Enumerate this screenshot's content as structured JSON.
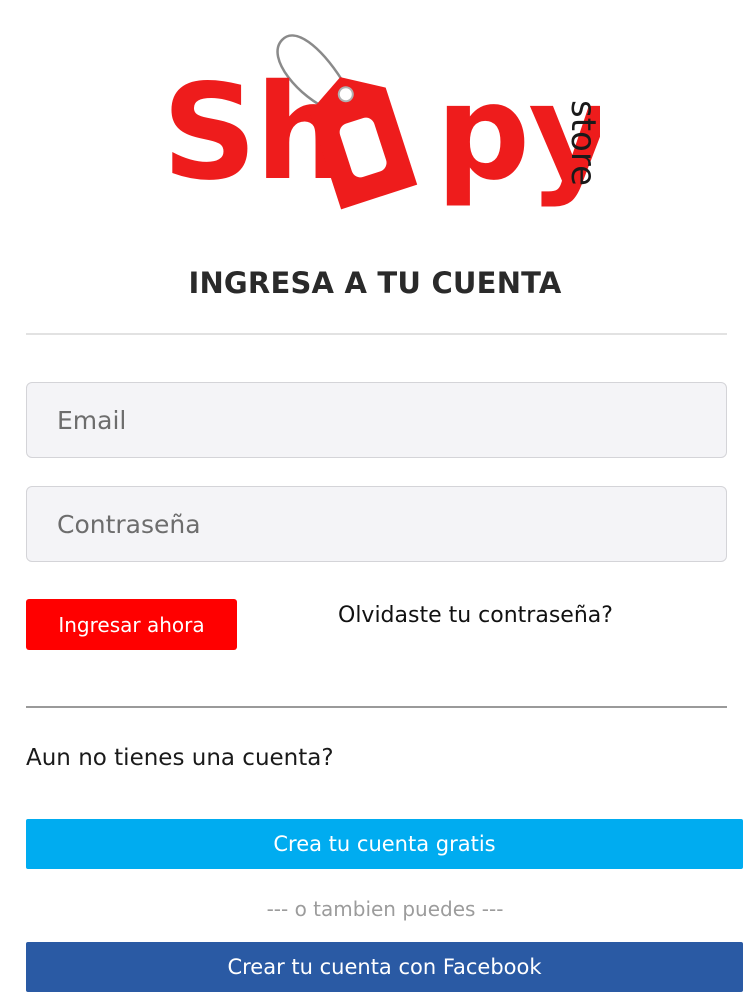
{
  "brand": {
    "logo_main": "Shopy",
    "logo_sub": "store",
    "color": "#ee1c1c"
  },
  "login": {
    "heading": "INGRESA A TU CUENTA",
    "email_placeholder": "Email",
    "password_placeholder": "Contraseña",
    "submit_label": "Ingresar ahora",
    "forgot_label": "Olvidaste tu contraseña?"
  },
  "register": {
    "prompt": "Aun no tienes una cuenta?",
    "create_label": "Crea tu cuenta gratis",
    "alt_text": "--- o tambien puedes ---",
    "facebook_label": "Crear tu cuenta con Facebook"
  },
  "colors": {
    "primary_red": "#ff0000",
    "create_blue": "#00acf0",
    "facebook_blue": "#2a5aa4"
  }
}
